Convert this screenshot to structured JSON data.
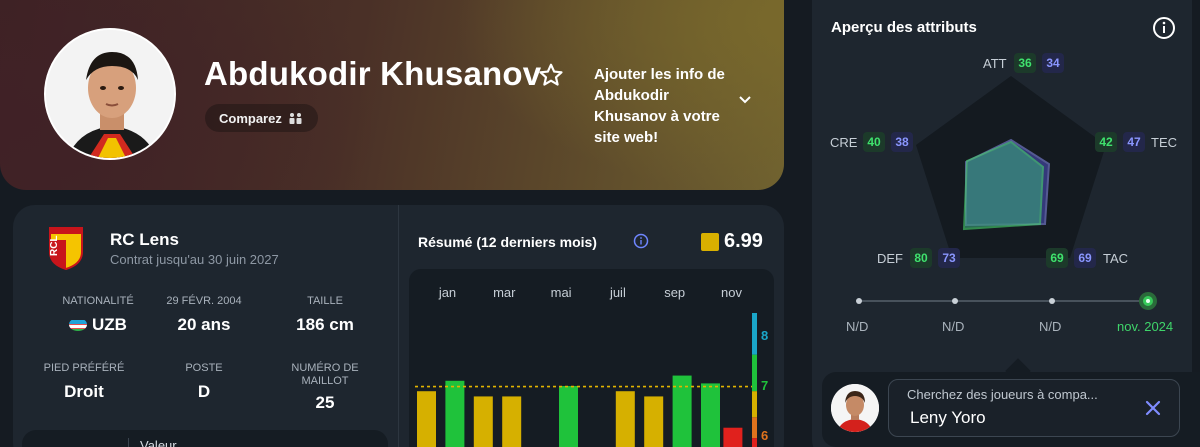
{
  "player": {
    "name": "Abdukodir Khusanov",
    "compare_label": "Comparez",
    "embed_text": "Ajouter les info de Abdukodir Khusanov à votre site web!"
  },
  "club": {
    "name": "RC Lens",
    "contract": "Contrat jusqu'au 30 juin 2027",
    "logo_text": "RCL"
  },
  "stats": {
    "nationality_label": "NATIONALITÉ",
    "nationality_value": "UZB",
    "birth_label": "29 FÉVR. 2004",
    "age_value": "20 ans",
    "height_label": "TAILLE",
    "height_value": "186 cm",
    "foot_label": "PIED PRÉFÉRÉ",
    "foot_value": "Droit",
    "position_label": "POSTE",
    "position_value": "D",
    "shirt_label_1": "NUMÉRO DE",
    "shirt_label_2": "MAILLOT",
    "shirt_value": "25"
  },
  "value_box": {
    "label": "Valeur"
  },
  "summary": {
    "title": "Résumé (12 derniers mois)",
    "rating": "6.99",
    "rating_color": "#d9b000"
  },
  "chart_data": {
    "type": "bar",
    "categories": [
      "jan",
      "",
      "mar",
      "",
      "mai",
      "",
      "juil",
      "",
      "sep",
      "",
      "nov",
      ""
    ],
    "month_labels": [
      "jan",
      "mar",
      "mai",
      "juil",
      "sep",
      "nov"
    ],
    "values": [
      6.9,
      7.1,
      6.8,
      6.8,
      null,
      7.0,
      null,
      6.9,
      6.8,
      7.2,
      7.05,
      6.2
    ],
    "average": 6.99,
    "y_ticks": [
      "8",
      "7",
      "6"
    ],
    "ylim": [
      5.6,
      8.4
    ],
    "colors": {
      "high": "#1fc23b",
      "mid": "#d6b000",
      "low": "#e0211d",
      "avg_line": "#e3b400"
    }
  },
  "attributes": {
    "title": "Aperçu des attributs",
    "items": [
      {
        "label": "ATT",
        "a": "36",
        "b": "34"
      },
      {
        "label": "TEC",
        "a": "42",
        "b": "47"
      },
      {
        "label": "TAC",
        "a": "69",
        "b": "69"
      },
      {
        "label": "DEF",
        "a": "80",
        "b": "73"
      },
      {
        "label": "CRE",
        "a": "40",
        "b": "38"
      }
    ],
    "timeline": [
      "N/D",
      "N/D",
      "N/D",
      "nov. 2024"
    ]
  },
  "search": {
    "placeholder": "Cherchez des joueurs à compa...",
    "value": "Leny Yoro"
  }
}
